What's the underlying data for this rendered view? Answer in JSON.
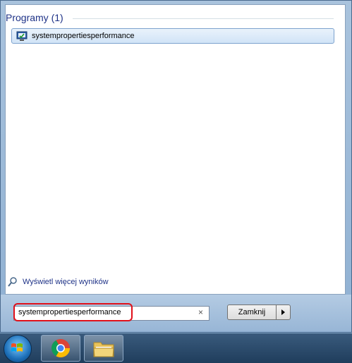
{
  "results": {
    "group_header": "Programy (1)",
    "items": [
      {
        "label": "systempropertiesperformance",
        "icon": "system-properties-icon"
      }
    ]
  },
  "more_results": {
    "label": "Wyświetl więcej wyników",
    "icon": "search-icon"
  },
  "search": {
    "value": "systempropertiesperformance",
    "clear_icon": "×"
  },
  "shutdown": {
    "label": "Zamknij",
    "arrow_icon": "triangle-right-icon"
  },
  "taskbar": {
    "items": [
      {
        "name": "start-button",
        "icon": "windows-logo-icon"
      },
      {
        "name": "chrome",
        "icon": "chrome-icon"
      },
      {
        "name": "windows-explorer",
        "icon": "folder-icon"
      }
    ]
  },
  "colors": {
    "header_text": "#1e3287",
    "highlight_border": "#e0101a",
    "selection_border": "#7da2ce"
  }
}
